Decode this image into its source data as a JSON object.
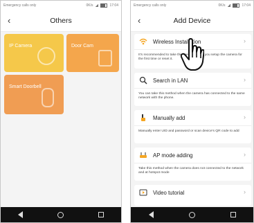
{
  "left": {
    "status": {
      "carrier": "Emergency calls only",
      "speed": "0K/s",
      "time": "17:04"
    },
    "header": {
      "title": "Others"
    },
    "tiles": [
      {
        "label": "IP Camera"
      },
      {
        "label": "Door Cam"
      },
      {
        "label": "Smart Doorbell"
      }
    ]
  },
  "right": {
    "status": {
      "carrier": "Emergency calls only",
      "speed": "0K/s",
      "time": "17:04"
    },
    "header": {
      "title": "Add Device"
    },
    "cards": [
      {
        "title": "Wireless Installation",
        "desc": "It's recommended to take this method when you setup the camera for the first time or reset it."
      },
      {
        "title": "Search in LAN",
        "desc": "You can take this method when the camera has connected to the same network with the phone."
      },
      {
        "title": "Manually add",
        "desc": "Manually enter UID and password or scan device's QR code to add"
      },
      {
        "title": "AP mode adding",
        "desc": "Take this method when the camera does not connected to the network and at hotspot mode"
      },
      {
        "title": "Video tutorial",
        "desc": ""
      }
    ]
  },
  "colors": {
    "accent": "#f5a623",
    "tile_ip": "#f5c84a",
    "tile_door": "#f4a64c",
    "tile_bell": "#f09d53"
  }
}
